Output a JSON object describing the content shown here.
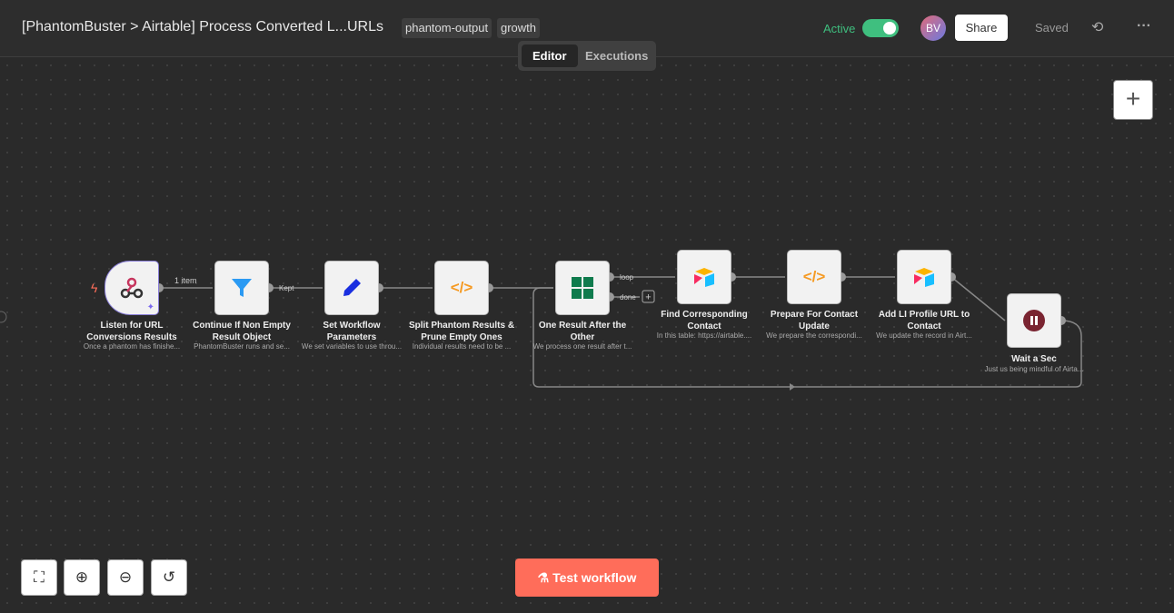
{
  "header": {
    "title": "[PhantomBuster > Airtable] Process Converted L...URLs",
    "tags": [
      "phantom-output",
      "growth"
    ],
    "active_label": "Active",
    "avatar": "BV",
    "share": "Share",
    "saved": "Saved"
  },
  "tabs": [
    "Editor",
    "Executions"
  ],
  "edges": {
    "item_count": "1 item",
    "kept": "Kept",
    "loop": "loop",
    "done": "done"
  },
  "nodes": [
    {
      "title": "Listen for URL Conversions Results",
      "subtitle": "Once a phantom has finishe..."
    },
    {
      "title": "Continue If Non Empty Result Object",
      "subtitle": "PhantomBuster runs and se..."
    },
    {
      "title": "Set Workflow Parameters",
      "subtitle": "We set variables to use throu..."
    },
    {
      "title": "Split Phantom Results & Prune Empty Ones",
      "subtitle": "Individual results need to be ..."
    },
    {
      "title": "One Result After the Other",
      "subtitle": "We process one result after t..."
    },
    {
      "title": "Find Corresponding Contact",
      "subtitle": "In this table: https://airtable...."
    },
    {
      "title": "Prepare For Contact Update",
      "subtitle": "We prepare the correspondi..."
    },
    {
      "title": "Add LI Profile URL to Contact",
      "subtitle": "We update the record in Airt..."
    },
    {
      "title": "Wait a Sec",
      "subtitle": "Just us being mindful of Airta..."
    }
  ],
  "footer": {
    "test_workflow": "Test workflow"
  }
}
